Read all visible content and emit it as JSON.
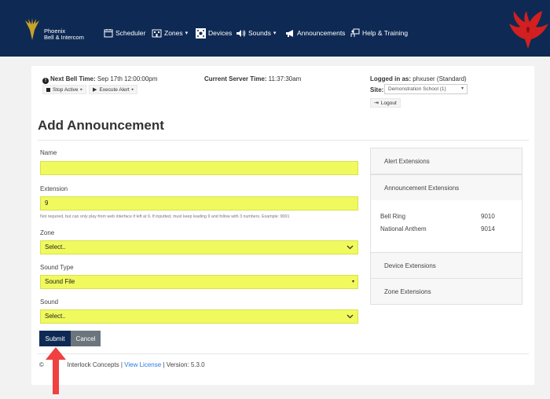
{
  "navbar": {
    "brand_line1": "Phoenix",
    "brand_line2": "Bell & Intercom",
    "items": [
      {
        "label": "Scheduler",
        "icon": "calendar-icon"
      },
      {
        "label": "Zones",
        "icon": "building-icon",
        "caret": "▾"
      },
      {
        "label": "Devices",
        "icon": "devices-icon"
      },
      {
        "label": "Sounds",
        "icon": "speaker-icon",
        "caret": "▾"
      },
      {
        "label": "Announcements",
        "icon": "megaphone-icon"
      },
      {
        "label": "Help & Training",
        "icon": "help-training-icon"
      }
    ],
    "colors": {
      "navbar_bg": "#0e2a54",
      "logo_red": "#d21f1f",
      "logo_gold": "#c9a227"
    }
  },
  "status": {
    "next_bell_label": "Next Bell Time:",
    "next_bell_value": "Sep 17th 12:00:00pm",
    "stop_active": "Stop Active",
    "execute_alert": "Execute Alert",
    "server_time_label": "Current Server Time:",
    "server_time_value": "11:37:30am"
  },
  "user": {
    "logged_in_label": "Logged in as:",
    "logged_in_value": "phxuser (Standard)",
    "site_label": "Site:",
    "site_value": "Demonstration School (1)",
    "logout": "Logout"
  },
  "page": {
    "title": "Add Announcement"
  },
  "form": {
    "name_label": "Name",
    "name_value": "",
    "extension_label": "Extension",
    "extension_value": "9",
    "extension_help": "Not required, but can only play from web interface if left at 9. If inputted, must keep leading 9 and follow with 3 numbers. Example: 9001",
    "zone_label": "Zone",
    "zone_value": "Select..",
    "sound_type_label": "Sound Type",
    "sound_type_value": "Sound File",
    "sound_label": "Sound",
    "sound_value": "Select..",
    "submit": "Submit",
    "cancel": "Cancel",
    "field_highlight_color": "#f0fa5e",
    "arrow_color": "#f04040"
  },
  "footer": {
    "prefix": "©",
    "company": "Interlock Concepts |",
    "license_link": "View License",
    "version": "| Version: 5.3.0"
  },
  "extensions_panel": {
    "alert": "Alert Extensions",
    "announcement": "Announcement Extensions",
    "rows": [
      {
        "name": "Bell Ring",
        "ext": "9010"
      },
      {
        "name": "National Anthem",
        "ext": "9014"
      }
    ],
    "device": "Device Extensions",
    "zone": "Zone Extensions"
  }
}
